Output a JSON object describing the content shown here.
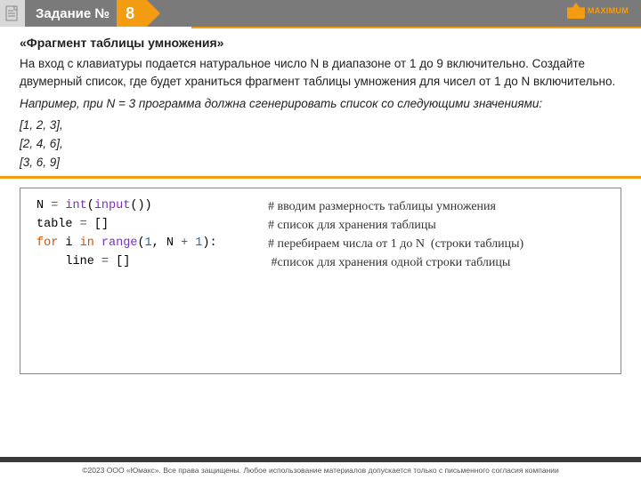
{
  "header": {
    "label": "Задание №",
    "number": "8",
    "logo_text": "MAXIMUM"
  },
  "body": {
    "title": "«Фрагмент таблицы умножения»",
    "p1": "На вход с клавиатуры подается натуральное число N в диапазоне от 1 до 9 включительно. Создайте двумерный список, где будет храниться фрагмент таблицы умножения для чисел от 1 до N включительно.",
    "p2": "Например, при N = 3 программа должна сгенерировать список со следующими значениями:",
    "ex1": "[1, 2, 3],",
    "ex2": "[2, 4, 6],",
    "ex3": "[3, 6, 9]"
  },
  "code": {
    "l1": {
      "a": "N ",
      "b": "= ",
      "c": "int",
      "d": "(",
      "e": "input",
      "f": "())",
      "comment": "# вводим размерность таблицы умножения"
    },
    "l2": {
      "a": "table ",
      "b": "= ",
      "c": "[]",
      "comment": "# список для хранения таблицы"
    },
    "l3": {
      "a": "for ",
      "b": "i ",
      "c": "in ",
      "d": "range",
      "e": "(",
      "f": "1",
      "g": ", N ",
      "h": "+ ",
      "i": "1",
      "j": "):",
      "comment": "# перебираем числа от 1 до N  (строки таблицы)"
    },
    "l4": {
      "a": "    line ",
      "b": "= ",
      "c": "[]",
      "comment": " #список для хранения одной строки таблицы"
    }
  },
  "footer": "©2023 ООО «Юмакс». Все права защищены. Любое использование материалов допускается только с письменного согласия компании"
}
